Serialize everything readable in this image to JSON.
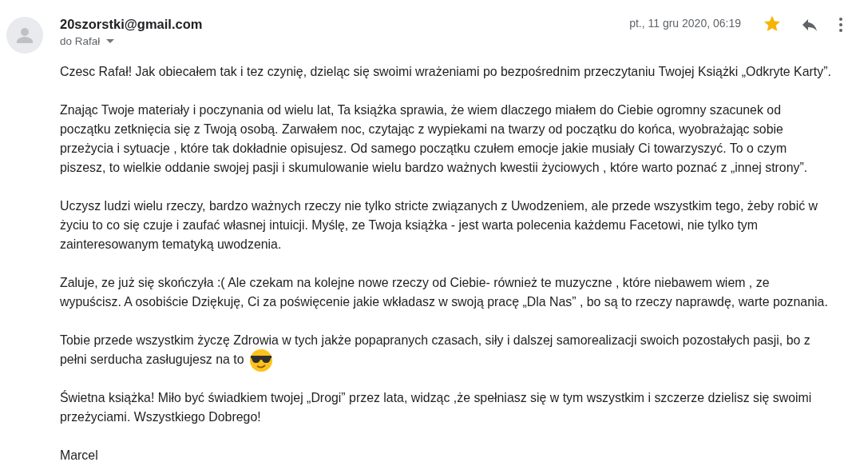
{
  "sender": "20szorstki@gmail.com",
  "recipient": "do Rafał",
  "date": "pt., 11 gru 2020, 06:19",
  "starred": true,
  "paragraphs": [
    {
      "text": "Czesc Rafał! Jak obiecałem tak i tez czynię, dzieląc się swoimi wrażeniami po bezpośrednim przeczytaniu Twojej Książki „Odkryte Karty”."
    },
    {
      "text": "Znając Twoje materiały i poczynania od wielu lat, Ta książka sprawia, że wiem dlaczego miałem do Ciebie ogromny szacunek od\npoczątku zetknięcia się z Twoją osobą. Zarwałem noc, czytając z wypiekami na twarzy od początku do końca, wyobrażając sobie\nprzeżycia i sytuacje , które tak dokładnie opisujesz. Od samego początku czułem emocje jakie musiały Ci towarzyszyć. To o czym\npiszesz, to wielkie oddanie swojej pasji i skumulowanie wielu bardzo ważnych kwestii życiowych , które warto poznać z „innej strony”."
    },
    {
      "text": "Uczysz ludzi wielu rzeczy, bardzo ważnych rzeczy nie tylko stricte związanych z Uwodzeniem, ale przede wszystkim tego, żeby robić w\nżyciu to co się czuje i zaufać własnej intuicji. Myślę, ze Twoja książka - jest warta polecenia każdemu Facetowi, nie tylko tym\nzainteresowanym tematyką uwodzenia."
    },
    {
      "text": "Zaluje, ze już się skończyła :( Ale czekam na kolejne nowe rzeczy od Ciebie- również te muzyczne , które niebawem wiem , ze\nwypuścisz. A osobiście Dziękuję, Ci za poświęcenie jakie wkładasz w swoją pracę „Dla Nas” , bo są to rzeczy naprawdę, warte poznania."
    },
    {
      "text": "Tobie przede wszystkim życzę Zdrowia w tych jakże popapranych czasach, siły i dalszej samorealizacji swoich pozostałych pasji, bo z\npełni serducha zasługujesz na to",
      "emoji": true
    },
    {
      "text": "Świetna książka! Miło być świadkiem twojej „Drogi” przez lata, widząc ,że spełniasz się w tym wszystkim i szczerze dzielisz się swoimi\nprzeżyciami. Wszystkiego Dobrego!"
    },
    {
      "text": "Marcel"
    }
  ]
}
